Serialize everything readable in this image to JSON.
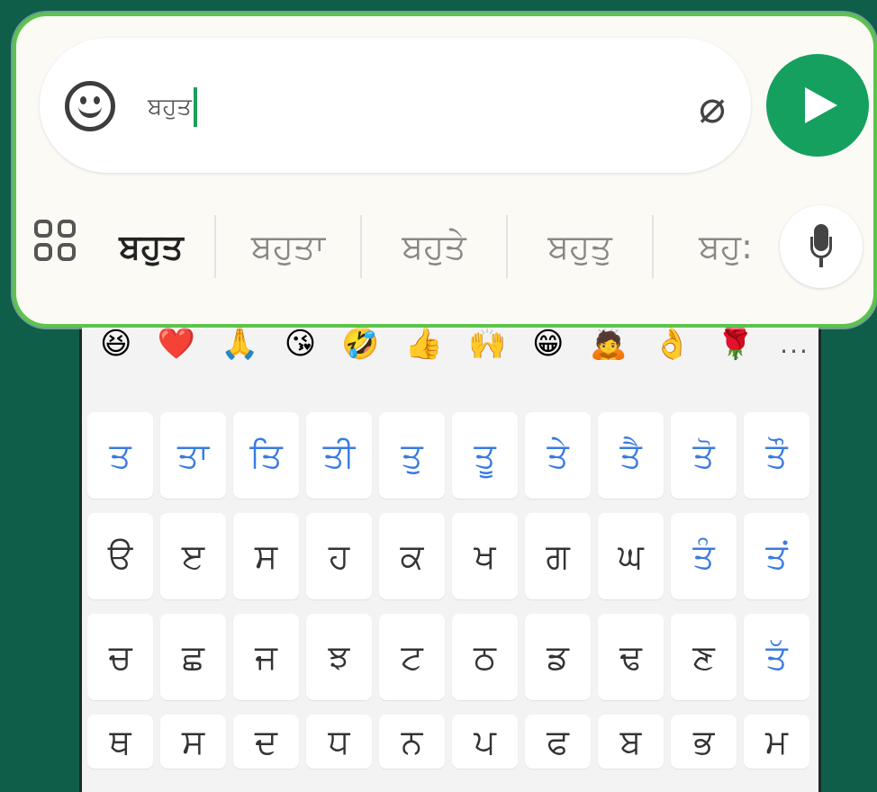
{
  "composer": {
    "typed_text": "ਬਹੁਤ",
    "emoji_icon": "smiley-icon",
    "attach_icon": "paperclip-icon",
    "send_icon": "send-arrow-icon",
    "accent": "#16a05f"
  },
  "suggestions": {
    "menu_icon": "grid-icon",
    "items": [
      "ਬਹੁਤ",
      "ਬਹੁਤਾ",
      "ਬਹੁਤੇ",
      "ਬਹੁਤੁ",
      "ਬਹੁ:"
    ],
    "mic_icon": "mic-icon"
  },
  "emoji_row": {
    "items": [
      "😆",
      "❤️",
      "🙏",
      "😘",
      "🤣",
      "👍",
      "🙌",
      "😁",
      "🙇",
      "👌",
      "🌹"
    ],
    "more": "..."
  },
  "keys": {
    "row1": [
      "ਤ",
      "ਤਾ",
      "ਤਿ",
      "ਤੀ",
      "ਤੁ",
      "ਤੂ",
      "ਤੇ",
      "ਤੈ",
      "ਤੋ",
      "ਤੌ"
    ],
    "row2": [
      "ੳ",
      "ੲ",
      "ਸ",
      "ਹ",
      "ਕ",
      "ਖ",
      "ਗ",
      "ਘ",
      "ਤੰ",
      "ਤਂ"
    ],
    "row3": [
      "ਚ",
      "ਛ",
      "ਜ",
      "ਝ",
      "ਟ",
      "ਠ",
      "ਡ",
      "ਢ",
      "ਣ",
      "ਤੱ"
    ],
    "row4": [
      "ਥ",
      "ਸ",
      "ਦ",
      "ਧ",
      "ਨ",
      "ਪ",
      "ਫ",
      "ਬ",
      "ਭ",
      "ਮ"
    ]
  }
}
